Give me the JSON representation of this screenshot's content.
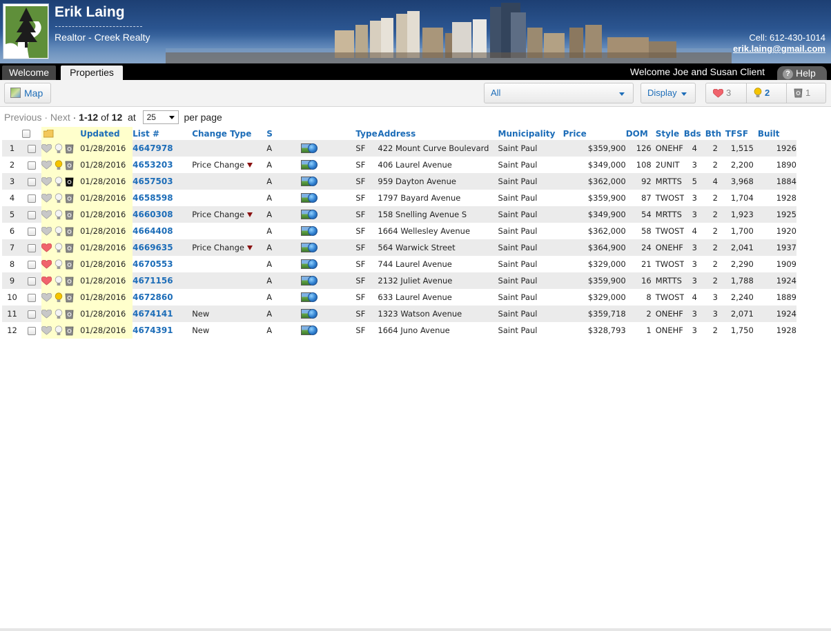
{
  "header": {
    "agent_name": "Erik Laing",
    "agent_title": "Realtor - Creek Realty",
    "cell": "Cell: 612-430-1014",
    "email": "erik.laing@gmail.com"
  },
  "tabs": {
    "welcome": "Welcome",
    "properties": "Properties",
    "greeting": "Welcome Joe and Susan Client",
    "help": "Help"
  },
  "toolbar": {
    "map_label": "Map",
    "filter_value": "All",
    "display_label": "Display",
    "favorites_count": "3",
    "ideas_count": "2",
    "trash_count": "1"
  },
  "pager": {
    "previous": "Previous",
    "next": "Next",
    "range": "1-12",
    "of_label": "of",
    "total": "12",
    "at_label": "at",
    "per_page_value": "25",
    "per_page_label": "per page"
  },
  "columns": {
    "updated": "Updated",
    "list": "List #",
    "change": "Change Type",
    "status": "S",
    "type": "Type",
    "address": "Address",
    "municipality": "Municipality",
    "price": "Price",
    "dom": "DOM",
    "style": "Style",
    "beds": "Bds",
    "baths": "Bth",
    "tfsf": "TFSF",
    "built": "Built"
  },
  "colors": {
    "link_blue": "#1d6db8",
    "heart_active": "#f0636c",
    "heart_inactive": "#c8c8c8",
    "bulb_active": "#f5c400",
    "highlight_yellow": "#ffffcc",
    "price_down_arrow": "#8a1111"
  },
  "rows": [
    {
      "n": "1",
      "heart": false,
      "bulb": false,
      "trash": false,
      "updated": "01/28/2016",
      "list": "4647978",
      "change": "",
      "down": false,
      "s": "A",
      "type": "SF",
      "address": "422 Mount Curve Boulevard",
      "municipality": "Saint Paul",
      "price": "$359,900",
      "dom": "126",
      "style": "ONEHF",
      "bds": "4",
      "bth": "2",
      "tfsf": "1,515",
      "built": "1926"
    },
    {
      "n": "2",
      "heart": false,
      "bulb": true,
      "trash": false,
      "updated": "01/28/2016",
      "list": "4653203",
      "change": "Price Change",
      "down": true,
      "s": "A",
      "type": "SF",
      "address": "406 Laurel Avenue",
      "municipality": "Saint Paul",
      "price": "$349,000",
      "dom": "108",
      "style": "2UNIT",
      "bds": "3",
      "bth": "2",
      "tfsf": "2,200",
      "built": "1890"
    },
    {
      "n": "3",
      "heart": false,
      "bulb": false,
      "trash": true,
      "updated": "01/28/2016",
      "list": "4657503",
      "change": "",
      "down": false,
      "s": "A",
      "type": "SF",
      "address": "959 Dayton Avenue",
      "municipality": "Saint Paul",
      "price": "$362,000",
      "dom": "92",
      "style": "MRTTS",
      "bds": "5",
      "bth": "4",
      "tfsf": "3,968",
      "built": "1884"
    },
    {
      "n": "4",
      "heart": false,
      "bulb": false,
      "trash": false,
      "updated": "01/28/2016",
      "list": "4658598",
      "change": "",
      "down": false,
      "s": "A",
      "type": "SF",
      "address": "1797 Bayard Avenue",
      "municipality": "Saint Paul",
      "price": "$359,900",
      "dom": "87",
      "style": "TWOST",
      "bds": "3",
      "bth": "2",
      "tfsf": "1,704",
      "built": "1928"
    },
    {
      "n": "5",
      "heart": false,
      "bulb": false,
      "trash": false,
      "updated": "01/28/2016",
      "list": "4660308",
      "change": "Price Change",
      "down": true,
      "s": "A",
      "type": "SF",
      "address": "158 Snelling Avenue S",
      "municipality": "Saint Paul",
      "price": "$349,900",
      "dom": "54",
      "style": "MRTTS",
      "bds": "3",
      "bth": "2",
      "tfsf": "1,923",
      "built": "1925"
    },
    {
      "n": "6",
      "heart": false,
      "bulb": false,
      "trash": false,
      "updated": "01/28/2016",
      "list": "4664408",
      "change": "",
      "down": false,
      "s": "A",
      "type": "SF",
      "address": "1664 Wellesley Avenue",
      "municipality": "Saint Paul",
      "price": "$362,000",
      "dom": "58",
      "style": "TWOST",
      "bds": "4",
      "bth": "2",
      "tfsf": "1,700",
      "built": "1920"
    },
    {
      "n": "7",
      "heart": true,
      "bulb": false,
      "trash": false,
      "updated": "01/28/2016",
      "list": "4669635",
      "change": "Price Change",
      "down": true,
      "s": "A",
      "type": "SF",
      "address": "564 Warwick Street",
      "municipality": "Saint Paul",
      "price": "$364,900",
      "dom": "24",
      "style": "ONEHF",
      "bds": "3",
      "bth": "2",
      "tfsf": "2,041",
      "built": "1937"
    },
    {
      "n": "8",
      "heart": true,
      "bulb": false,
      "trash": false,
      "updated": "01/28/2016",
      "list": "4670553",
      "change": "",
      "down": false,
      "s": "A",
      "type": "SF",
      "address": "744 Laurel Avenue",
      "municipality": "Saint Paul",
      "price": "$329,000",
      "dom": "21",
      "style": "TWOST",
      "bds": "3",
      "bth": "2",
      "tfsf": "2,290",
      "built": "1909"
    },
    {
      "n": "9",
      "heart": true,
      "bulb": false,
      "trash": false,
      "updated": "01/28/2016",
      "list": "4671156",
      "change": "",
      "down": false,
      "s": "A",
      "type": "SF",
      "address": "2132 Juliet Avenue",
      "municipality": "Saint Paul",
      "price": "$359,900",
      "dom": "16",
      "style": "MRTTS",
      "bds": "3",
      "bth": "2",
      "tfsf": "1,788",
      "built": "1924"
    },
    {
      "n": "10",
      "heart": false,
      "bulb": true,
      "trash": false,
      "updated": "01/28/2016",
      "list": "4672860",
      "change": "",
      "down": false,
      "s": "A",
      "type": "SF",
      "address": "633 Laurel Avenue",
      "municipality": "Saint Paul",
      "price": "$329,000",
      "dom": "8",
      "style": "TWOST",
      "bds": "4",
      "bth": "3",
      "tfsf": "2,240",
      "built": "1889"
    },
    {
      "n": "11",
      "heart": false,
      "bulb": false,
      "trash": false,
      "updated": "01/28/2016",
      "list": "4674141",
      "change": "New",
      "down": false,
      "s": "A",
      "type": "SF",
      "address": "1323 Watson Avenue",
      "municipality": "Saint Paul",
      "price": "$359,718",
      "dom": "2",
      "style": "ONEHF",
      "bds": "3",
      "bth": "3",
      "tfsf": "2,071",
      "built": "1924"
    },
    {
      "n": "12",
      "heart": false,
      "bulb": false,
      "trash": false,
      "updated": "01/28/2016",
      "list": "4674391",
      "change": "New",
      "down": false,
      "s": "A",
      "type": "SF",
      "address": "1664 Juno Avenue",
      "municipality": "Saint Paul",
      "price": "$328,793",
      "dom": "1",
      "style": "ONEHF",
      "bds": "3",
      "bth": "2",
      "tfsf": "1,750",
      "built": "1928"
    }
  ]
}
